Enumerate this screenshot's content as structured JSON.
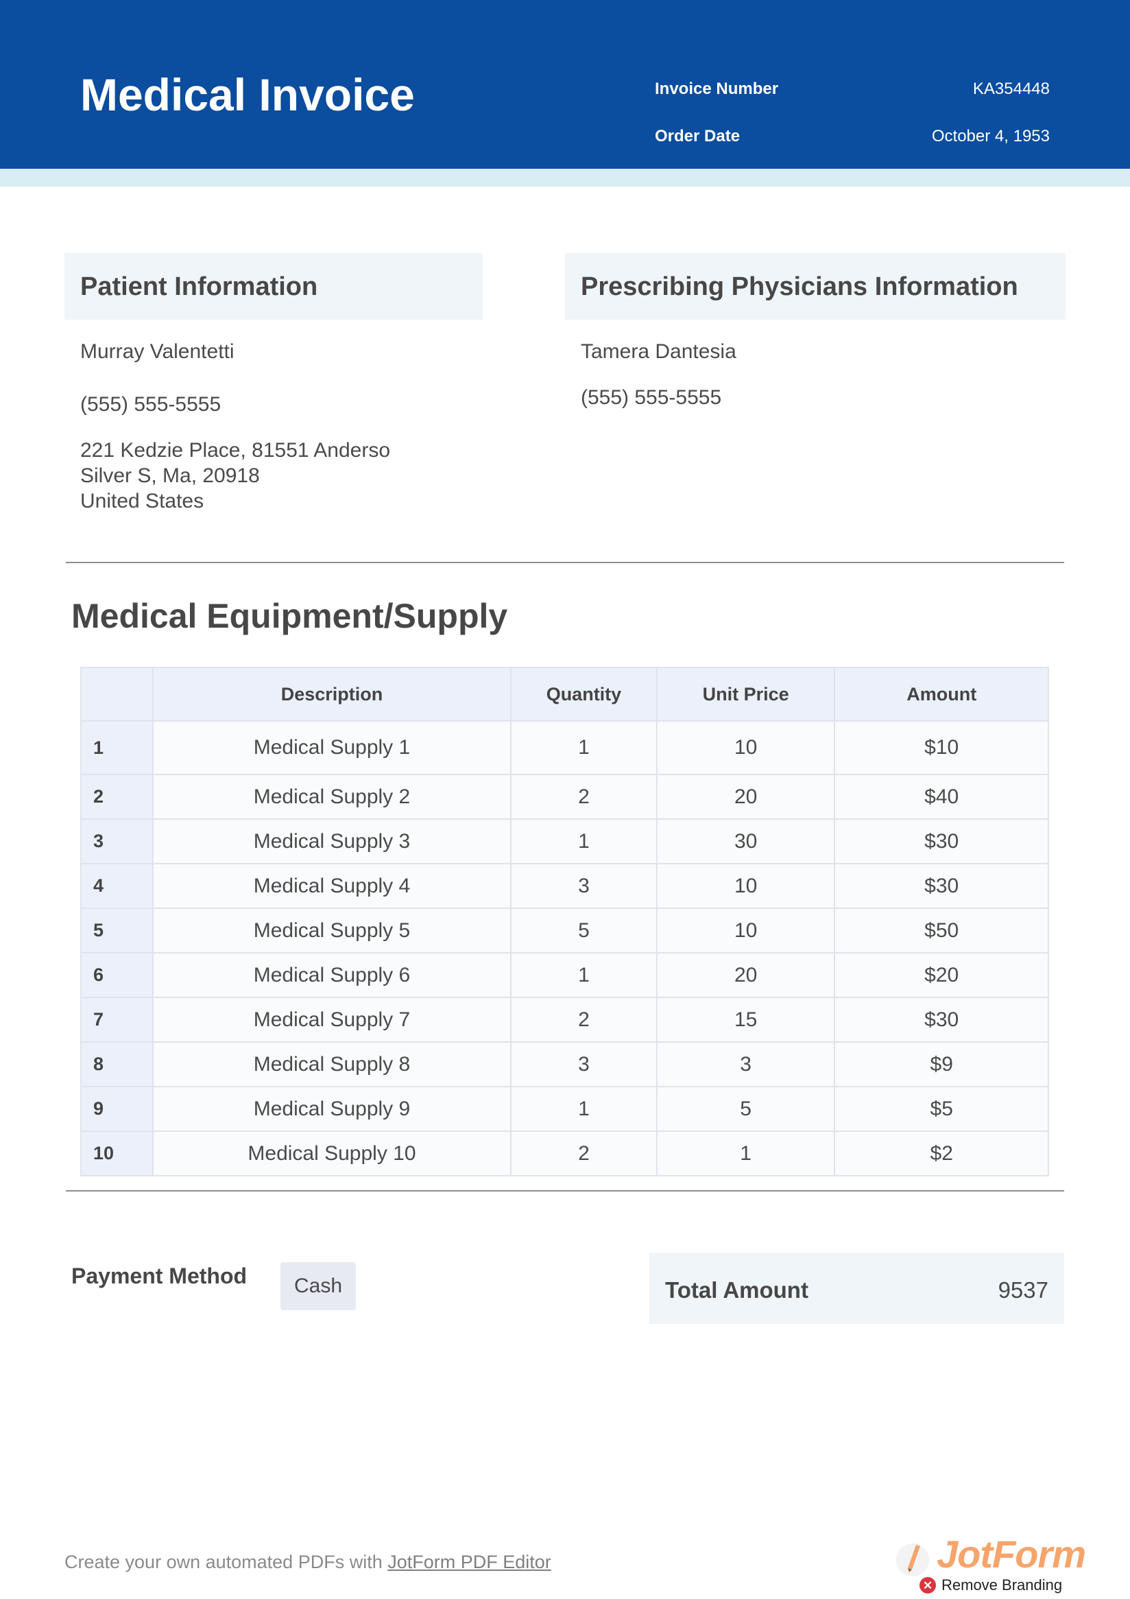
{
  "header": {
    "title": "Medical Invoice",
    "invoice_number_label": "Invoice Number",
    "invoice_number": "KA354448",
    "order_date_label": "Order Date",
    "order_date": "October 4, 1953"
  },
  "patient": {
    "heading": "Patient Information",
    "name": "Murray Valentetti",
    "phone": "(555) 555-5555",
    "address_line1": "221 Kedzie Place, 81551 Anderso",
    "address_line2": "Silver S, Ma, 20918",
    "address_line3": "United States"
  },
  "physician": {
    "heading": "Prescribing Physicians Information",
    "name": "Tamera Dantesia",
    "phone": "(555) 555-5555"
  },
  "equipment": {
    "heading": "Medical Equipment/Supply",
    "columns": [
      "",
      "Description",
      "Quantity",
      "Unit Price",
      "Amount"
    ],
    "rows": [
      {
        "num": "1",
        "description": "Medical Supply 1",
        "quantity": "1",
        "unit_price": "10",
        "amount": "$10"
      },
      {
        "num": "2",
        "description": "Medical Supply 2",
        "quantity": "2",
        "unit_price": "20",
        "amount": "$40"
      },
      {
        "num": "3",
        "description": "Medical Supply 3",
        "quantity": "1",
        "unit_price": "30",
        "amount": "$30"
      },
      {
        "num": "4",
        "description": "Medical Supply 4",
        "quantity": "3",
        "unit_price": "10",
        "amount": "$30"
      },
      {
        "num": "5",
        "description": "Medical Supply 5",
        "quantity": "5",
        "unit_price": "10",
        "amount": "$50"
      },
      {
        "num": "6",
        "description": "Medical Supply 6",
        "quantity": "1",
        "unit_price": "20",
        "amount": "$20"
      },
      {
        "num": "7",
        "description": "Medical Supply 7",
        "quantity": "2",
        "unit_price": "15",
        "amount": "$30"
      },
      {
        "num": "8",
        "description": "Medical Supply 8",
        "quantity": "3",
        "unit_price": "3",
        "amount": "$9"
      },
      {
        "num": "9",
        "description": "Medical Supply 9",
        "quantity": "1",
        "unit_price": "5",
        "amount": "$5"
      },
      {
        "num": "10",
        "description": "Medical Supply 10",
        "quantity": "2",
        "unit_price": "1",
        "amount": "$2"
      }
    ]
  },
  "payment": {
    "label": "Payment Method",
    "method": "Cash"
  },
  "total": {
    "label": "Total Amount",
    "value": "9537"
  },
  "footer": {
    "text": "Create your own automated PDFs with ",
    "link_text": "JotForm PDF Editor",
    "logo_text": "JotForm",
    "remove_branding": "Remove Branding",
    "logo_icon": "jotform-pencil-icon",
    "close_icon": "close-circle-icon"
  },
  "colors": {
    "header_bg": "#0b4d9e",
    "header_stripe": "#d8edf4",
    "section_bg": "#f0f5f9",
    "table_header_bg": "#ebf0fa",
    "logo_orange": "#f7a46b",
    "remove_red": "#d9363e"
  }
}
